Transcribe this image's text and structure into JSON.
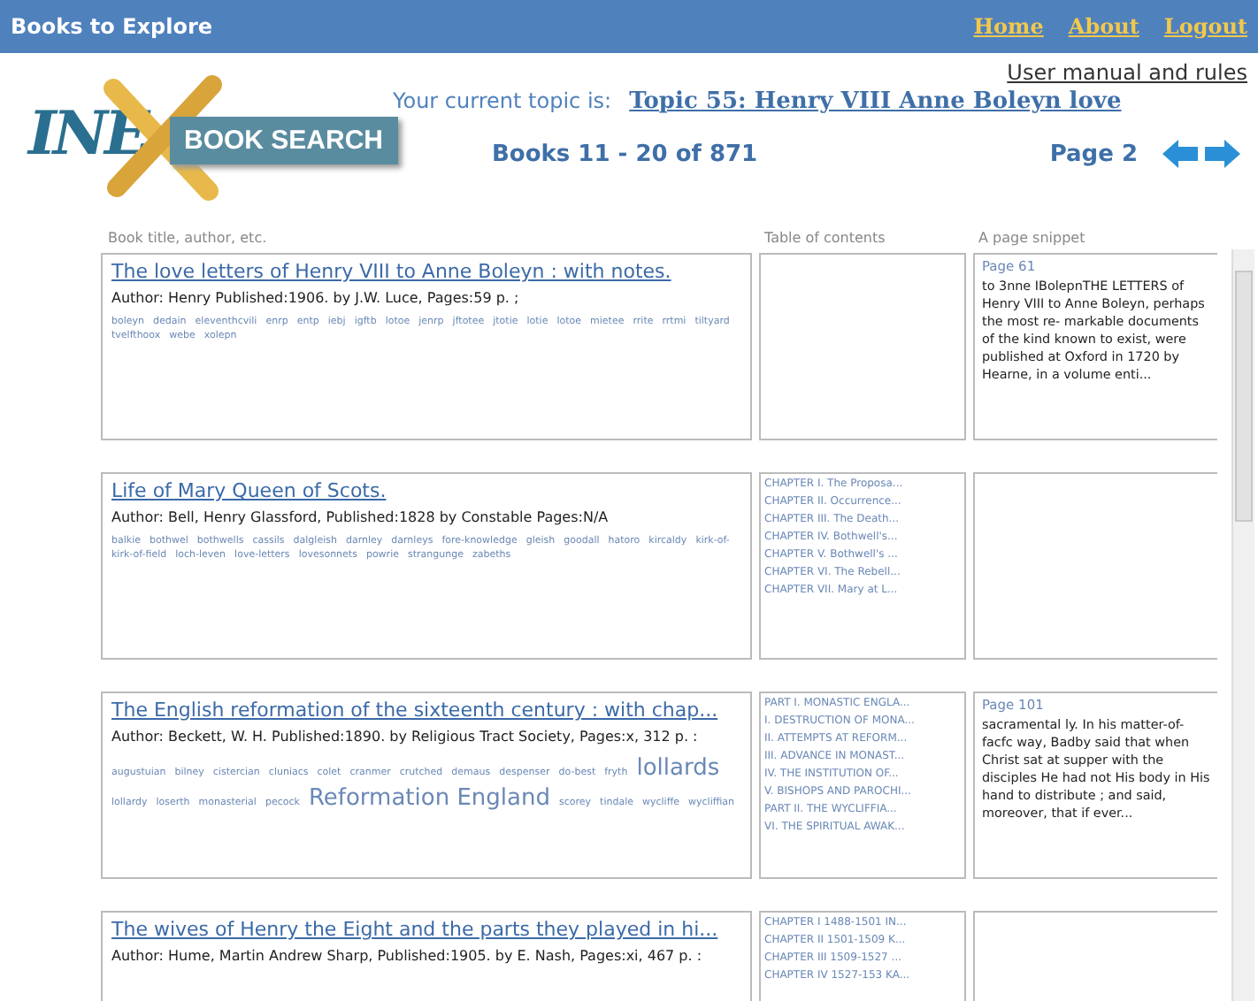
{
  "header": {
    "title": "Books to Explore",
    "links": [
      "Home",
      "About",
      "Logout"
    ]
  },
  "logo": {
    "mark": "INE",
    "text": "BOOK SEARCH"
  },
  "manual_link": "User manual and rules",
  "topic": {
    "label": "Your current topic is:",
    "value": "Topic 55: Henry VIII Anne Boleyn love"
  },
  "range": "Books 11 - 20 of 871",
  "page": "Page 2",
  "columns": [
    "Book title, author, etc.",
    "Table of contents",
    "A page snippet"
  ],
  "books": [
    {
      "title": "The love letters of Henry VIII to Anne Boleyn : with notes.",
      "meta": "Author: Henry Published:1906. by J.W. Luce, Pages:59 p. ;",
      "tags": [
        {
          "text": "boleyn",
          "big": false
        },
        {
          "text": "dedain",
          "big": false
        },
        {
          "text": "eleventhcvili",
          "big": false
        },
        {
          "text": "enrp",
          "big": false
        },
        {
          "text": "entp",
          "big": false
        },
        {
          "text": "iebj",
          "big": false
        },
        {
          "text": "igftb",
          "big": false
        },
        {
          "text": "lotoe",
          "big": false
        },
        {
          "text": "jenrp",
          "big": false
        },
        {
          "text": "jftotee",
          "big": false
        },
        {
          "text": "jtotie",
          "big": false
        },
        {
          "text": "lotie",
          "big": false
        },
        {
          "text": "lotoe",
          "big": false
        },
        {
          "text": "mietee",
          "big": false
        },
        {
          "text": "rrite",
          "big": false
        },
        {
          "text": "rrtmi",
          "big": false
        },
        {
          "text": "tiltyard",
          "big": false
        },
        {
          "text": "tvelfthoox",
          "big": false
        },
        {
          "text": "webe",
          "big": false
        },
        {
          "text": "xolepn",
          "big": false
        }
      ],
      "snippet": {
        "page": "Page 61",
        "text": "to 3nne IBolepnTHE LETTERS of Henry VIII to Anne Boleyn, perhaps the most re- markable documents of the kind known to exist, were published at Oxford in 1720 by Hearne, in a volume enti..."
      }
    },
    {
      "title": "Life of Mary Queen of Scots.",
      "meta": "Author: Bell, Henry Glassford, Published:1828 by Constable Pages:N/A",
      "tags": [
        {
          "text": "balkie",
          "big": false
        },
        {
          "text": "bothwel",
          "big": false
        },
        {
          "text": "bothwells",
          "big": false
        },
        {
          "text": "cassils",
          "big": false
        },
        {
          "text": "dalgleish",
          "big": false
        },
        {
          "text": "darnley",
          "big": false
        },
        {
          "text": "darnleys",
          "big": false
        },
        {
          "text": "fore-knowledge",
          "big": false
        },
        {
          "text": "gleish",
          "big": false
        },
        {
          "text": "goodall",
          "big": false
        },
        {
          "text": "hatoro",
          "big": false
        },
        {
          "text": "kircaldy",
          "big": false
        },
        {
          "text": "kirk-of-",
          "big": false
        },
        {
          "text": "kirk-of-field",
          "big": false
        },
        {
          "text": "loch-leven",
          "big": false
        },
        {
          "text": "love-letters",
          "big": false
        },
        {
          "text": "lovesonnets",
          "big": false
        },
        {
          "text": "powrie",
          "big": false
        },
        {
          "text": "strangunge",
          "big": false
        },
        {
          "text": "zabeths",
          "big": false
        }
      ],
      "toc": [
        "CHAPTER I. The Proposa...",
        "CHAPTER II. Occurrence...",
        "CHAPTER III. The Death...",
        "CHAPTER IV. Bothwell's...",
        "CHAPTER V. Bothwell's ...",
        "CHAPTER VI. The Rebell...",
        "CHAPTER VII. Mary at L..."
      ]
    },
    {
      "title": "The English reformation of the sixteenth century : with chap...",
      "meta": "Author: Beckett, W. H. Published:1890. by Religious Tract Society, Pages:x, 312 p. :",
      "tags": [
        {
          "text": "augustuian",
          "big": false
        },
        {
          "text": "bilney",
          "big": false
        },
        {
          "text": "cistercian",
          "big": false
        },
        {
          "text": "cluniacs",
          "big": false
        },
        {
          "text": "colet",
          "big": false
        },
        {
          "text": "cranmer",
          "big": false
        },
        {
          "text": "crutched",
          "big": false
        },
        {
          "text": "demaus",
          "big": false
        },
        {
          "text": "despenser",
          "big": false
        },
        {
          "text": "do-best",
          "big": false
        },
        {
          "text": "fryth",
          "big": false
        },
        {
          "text": "lollards",
          "big": true
        },
        {
          "text": "lollardy",
          "big": false
        },
        {
          "text": "loserth",
          "big": false
        },
        {
          "text": "monasterial",
          "big": false
        },
        {
          "text": "pecock",
          "big": false
        },
        {
          "text": "Reformation England",
          "big": true
        },
        {
          "text": "scorey",
          "big": false
        },
        {
          "text": "tindale",
          "big": false
        },
        {
          "text": "wycliffe",
          "big": false
        },
        {
          "text": "wycliffian",
          "big": false
        }
      ],
      "toc": [
        "PART I. MONASTIC ENGLA...",
        "I. DESTRUCTION OF MONA...",
        "II. ATTEMPTS AT REFORM...",
        "III. ADVANCE IN MONAST...",
        "IV. THE INSTITUTION OF...",
        "V. BISHOPS AND PAROCHI...",
        "PART II. THE WYCLIFFIA...",
        "VI. THE SPIRITUAL AWAK..."
      ],
      "snippet": {
        "page": "Page 101",
        "text": "sacramental ly. In his matter-of-facfc way, Badby said that when Christ sat at supper with the disciples He had not His body in His hand to distribute ; and said, moreover, that if ever..."
      }
    },
    {
      "title": "The wives of Henry the Eight and the parts they played in hi...",
      "meta": "Author: Hume, Martin Andrew Sharp, Published:1905. by E. Nash, Pages:xi, 467 p. :",
      "toc": [
        "CHAPTER I 1488-1501 IN...",
        "CHAPTER II 1501-1509 K...",
        "CHAPTER III 1509-1527 ...",
        "CHAPTER IV 1527-153 KA..."
      ]
    }
  ]
}
